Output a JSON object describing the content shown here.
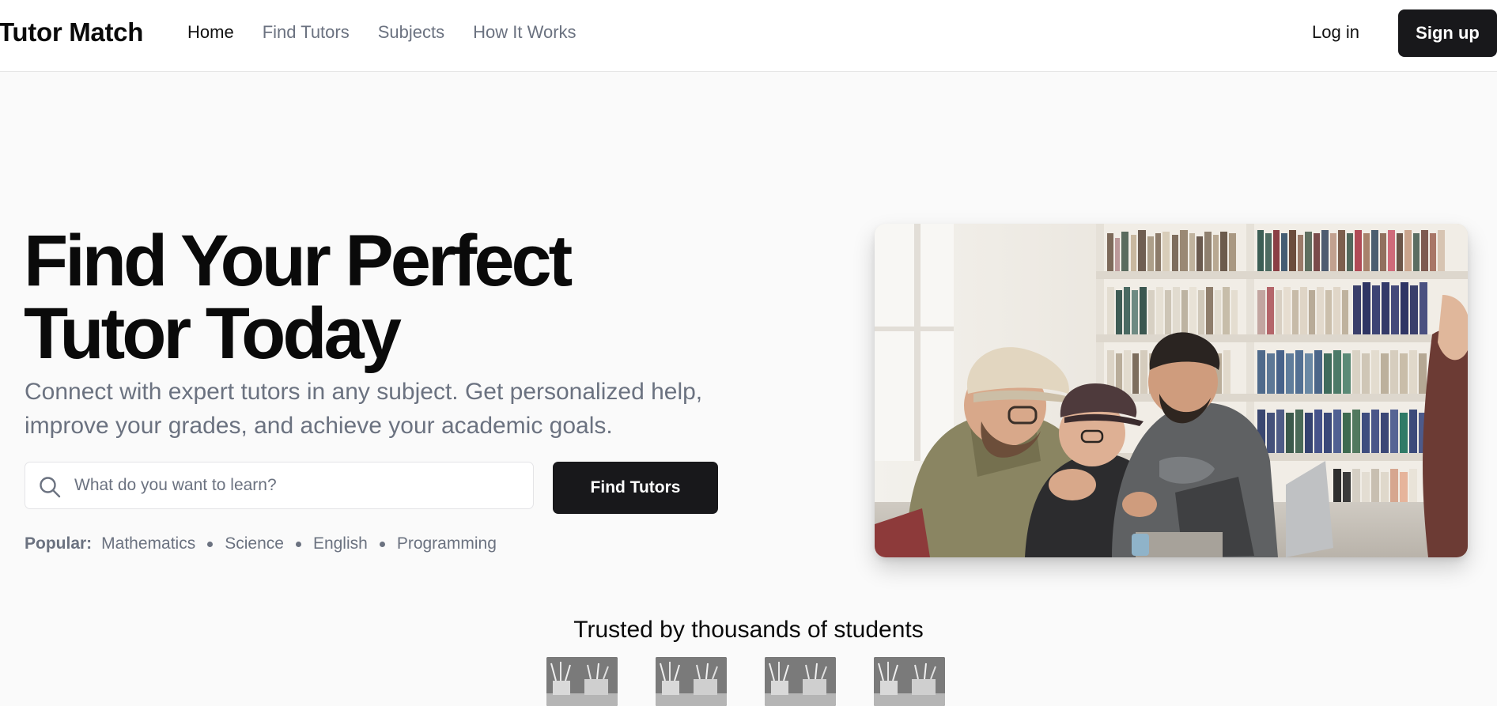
{
  "header": {
    "brand": "Tutor  Match",
    "nav": [
      "Home",
      "Find Tutors",
      "Subjects",
      "How It Works"
    ],
    "login": "Log in",
    "signup": "Sign up"
  },
  "hero": {
    "title_line1": "Find Your Perfect",
    "title_line2": "Tutor Today",
    "subtitle": "Connect with expert tutors in any subject. Get personalized help, improve your grades, and achieve your academic goals.",
    "search": {
      "placeholder": "What do you want to learn?",
      "value": ""
    },
    "find_button": "Find Tutors",
    "popular_label": "Popular:",
    "popular": [
      "Mathematics",
      "Science",
      "English",
      "Programming"
    ]
  },
  "trusted": {
    "heading": "Trusted by thousands of students",
    "logo_count": 4
  },
  "icons": {
    "search": "search-icon"
  },
  "colors": {
    "primary": "#18181b",
    "muted_text": "#6b7280",
    "page_bg": "#fafafa",
    "header_bg": "#ffffff"
  }
}
